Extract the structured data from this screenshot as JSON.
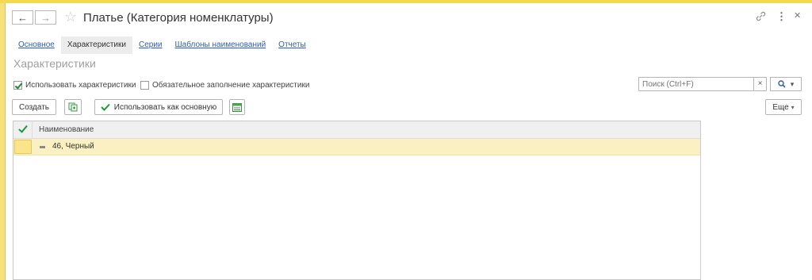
{
  "window": {
    "title": "Платье (Категория номенклатуры)",
    "back_icon": "arrow-left-icon",
    "forward_icon": "arrow-right-icon",
    "favorite_icon": "star-icon",
    "link_icon": "link-icon",
    "menu_icon": "more-vertical-icon",
    "close_icon": "close-icon"
  },
  "tabs": [
    {
      "label": "Основное",
      "active": false
    },
    {
      "label": "Характеристики",
      "active": true
    },
    {
      "label": "Серии",
      "active": false
    },
    {
      "label": "Шаблоны наименований",
      "active": false
    },
    {
      "label": "Отчеты",
      "active": false
    }
  ],
  "section_title": "Характеристики",
  "options": {
    "use_characteristics": {
      "label": "Использовать характеристики",
      "checked": true
    },
    "mandatory_fill": {
      "label": "Обязательное заполнение характеристики",
      "checked": false
    }
  },
  "search": {
    "placeholder": "Поиск (Ctrl+F)",
    "value": ""
  },
  "toolbar": {
    "create_label": "Создать",
    "use_as_main_label": "Использовать как основную",
    "more_label": "Еще"
  },
  "table": {
    "columns": [
      "Наименование"
    ],
    "rows": [
      {
        "name": "46, Черный"
      }
    ]
  },
  "colors": {
    "accent_green": "#1a9a3a",
    "link_blue": "#2f5ea8",
    "selected_row": "#faf0c2",
    "app_frame": "#fbeb8e"
  }
}
